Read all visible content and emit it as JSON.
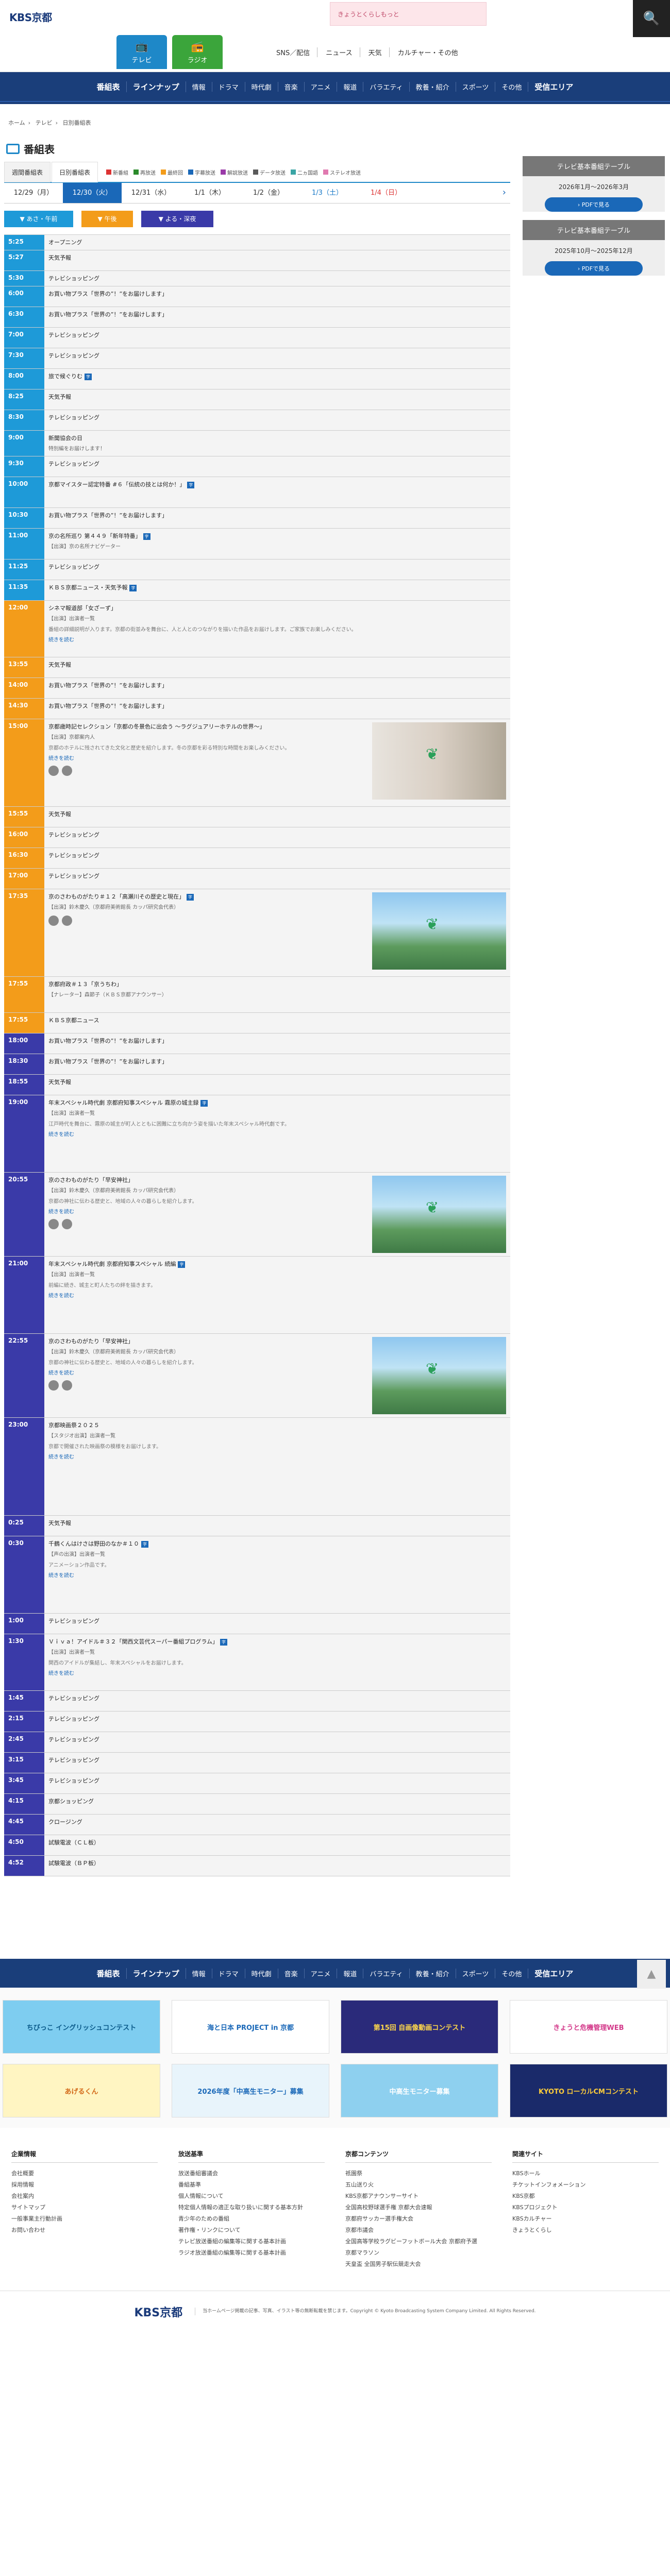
{
  "header": {
    "logo": "KBS京都",
    "banner": "きょうとくらしもっと",
    "tabs": [
      {
        "label": "テレビ",
        "icon": "tv-icon"
      },
      {
        "label": "ラジオ",
        "icon": "radio-icon"
      }
    ],
    "links": [
      "SNS／配信",
      "ニュース",
      "天気",
      "カルチャー・その他"
    ],
    "search_icon": "🔍"
  },
  "nav": [
    "番組表",
    "ラインナップ",
    "情報",
    "ドラマ",
    "時代劇",
    "音楽",
    "アニメ",
    "報道",
    "バラエティ",
    "教養・紹介",
    "スポーツ",
    "その他",
    "受信エリア"
  ],
  "breadcrumb": [
    "ホーム",
    "テレビ",
    "日別番組表"
  ],
  "page_title": "番組表",
  "view_tabs": [
    "週間番組表",
    "日別番組表"
  ],
  "filters": [
    {
      "label": "新番組",
      "color": "#d33"
    },
    {
      "label": "再放送",
      "color": "#2a8a2a"
    },
    {
      "label": "最終回",
      "color": "#f39c1a"
    },
    {
      "label": "字幕放送",
      "color": "#1a68b8"
    },
    {
      "label": "解説放送",
      "color": "#9a3aa8"
    },
    {
      "label": "データ放送",
      "color": "#5a5a5a"
    },
    {
      "label": "二ヵ国語",
      "color": "#3ba5a5"
    },
    {
      "label": "ステレオ放送",
      "color": "#e07ab0"
    }
  ],
  "dates": [
    {
      "label": "12/29（月）",
      "cls": ""
    },
    {
      "label": "12/30（火）",
      "cls": "active"
    },
    {
      "label": "12/31（水）",
      "cls": ""
    },
    {
      "label": "1/1（木）",
      "cls": ""
    },
    {
      "label": "1/2（金）",
      "cls": ""
    },
    {
      "label": "1/3（土）",
      "cls": "sat"
    },
    {
      "label": "1/4（日）",
      "cls": "sun"
    }
  ],
  "tod": [
    {
      "label": "あさ・午前",
      "cls": "morning"
    },
    {
      "label": "午後",
      "cls": "noon"
    },
    {
      "label": "よる・深夜",
      "cls": "night"
    }
  ],
  "side": [
    {
      "title": "テレビ基本番組テーブル",
      "period": "2026年1月〜2026年3月",
      "button": "PDFで見る"
    },
    {
      "title": "テレビ基本番組テーブル",
      "period": "2025年10月〜2025年12月",
      "button": "PDFで見る"
    }
  ],
  "schedule": [
    {
      "time": "5:25",
      "tod": "morning",
      "title": "オープニング",
      "h": 30
    },
    {
      "time": "5:27",
      "tod": "morning",
      "title": "天気予報",
      "h": 40
    },
    {
      "time": "5:30",
      "tod": "morning",
      "title": "テレビショッピング",
      "h": 30
    },
    {
      "time": "6:00",
      "tod": "morning",
      "title": "お買い物プラス「世界の”！”をお届けします」",
      "h": 40
    },
    {
      "time": "6:30",
      "tod": "morning",
      "title": "お買い物プラス「世界の”！”をお届けします」",
      "h": 40
    },
    {
      "time": "7:00",
      "tod": "morning",
      "title": "テレビショッピング",
      "h": 40
    },
    {
      "time": "7:30",
      "tod": "morning",
      "title": "テレビショッピング",
      "h": 40
    },
    {
      "time": "8:00",
      "tod": "morning",
      "title": "旅で候ぐりむ",
      "badge": "字",
      "h": 40
    },
    {
      "time": "8:25",
      "tod": "morning",
      "title": "天気予報",
      "h": 40
    },
    {
      "time": "8:30",
      "tod": "morning",
      "title": "テレビショッピング",
      "h": 40
    },
    {
      "time": "9:00",
      "tod": "morning",
      "title": "新聞協会の日",
      "sub": "特別編をお届けします！",
      "h": 50
    },
    {
      "time": "9:30",
      "tod": "morning",
      "title": "テレビショッピング",
      "h": 40
    },
    {
      "time": "10:00",
      "tod": "morning",
      "title": "京都マイスター認定特番 #６「伝統の技とは何か！」",
      "badge": "字",
      "h": 60
    },
    {
      "time": "10:30",
      "tod": "morning",
      "title": "お買い物プラス「世界の”！”をお届けします」",
      "h": 40
    },
    {
      "time": "11:00",
      "tod": "morning",
      "title": "京の名所巡り 第４４９「新年特番」",
      "badge": "字",
      "sub": "【出演】京の名所ナビゲーター",
      "h": 60
    },
    {
      "time": "11:25",
      "tod": "morning",
      "title": "テレビショッピング",
      "h": 40
    },
    {
      "time": "11:35",
      "tod": "morning",
      "title": "ＫＢＳ京都ニュース・天気予報",
      "badge": "字",
      "h": 40
    },
    {
      "time": "12:00",
      "tod": "noon",
      "title": "シネマ報道部「女ざーず」",
      "sub": "【出演】出演者一覧",
      "desc": "番組の詳細説明が入ります。京都の街並みを舞台に、人と人とのつながりを描いた作品をお届けします。ご家族でお楽しみください。",
      "more": "続きを読む",
      "h": 110
    },
    {
      "time": "13:55",
      "tod": "noon",
      "title": "天気予報",
      "h": 40
    },
    {
      "time": "14:00",
      "tod": "noon",
      "title": "お買い物プラス「世界の”！”をお届けします」",
      "h": 40
    },
    {
      "time": "14:30",
      "tod": "noon",
      "title": "お買い物プラス「世界の”！”をお届けします」",
      "h": 40
    },
    {
      "time": "15:00",
      "tod": "noon",
      "title": "京都歳時記セレクション「京都の冬景色に出会う ～ラグジュアリーホテルの世界～」",
      "sub": "【出演】京都案内人",
      "desc": "京都のホテルに残されてきた文化と歴史を紹介します。冬の京都を彩る特別な時間をお楽しみください。",
      "more": "続きを読む",
      "thumb": "rosary",
      "share": true,
      "h": 170
    },
    {
      "time": "15:55",
      "tod": "noon",
      "title": "天気予報",
      "h": 40
    },
    {
      "time": "16:00",
      "tod": "noon",
      "title": "テレビショッピング",
      "h": 40
    },
    {
      "time": "16:30",
      "tod": "noon",
      "title": "テレビショッピング",
      "h": 40
    },
    {
      "time": "17:00",
      "tod": "noon",
      "title": "テレビショッピング",
      "h": 40
    },
    {
      "time": "17:35",
      "tod": "noon",
      "title": "京のさわものがたり＃１２「高瀬川その歴史と現在」",
      "badge": "字",
      "sub": "【出演】鈴木慶久（京都府美術館長 カッパ研究会代表）",
      "thumb": "river",
      "share": true,
      "h": 170
    },
    {
      "time": "17:55",
      "tod": "noon",
      "title": "京都府政＃１３「京うちわ」",
      "sub": "【ナレーター】森節子（ＫＢＳ京都アナウンサー）",
      "h": 70
    },
    {
      "time": "17:55",
      "tod": "noon",
      "title": "ＫＢＳ京都ニュース",
      "h": 40
    },
    {
      "time": "18:00",
      "tod": "night",
      "title": "お買い物プラス「世界の”！”をお届けします」",
      "h": 40
    },
    {
      "time": "18:30",
      "tod": "night",
      "title": "お買い物プラス「世界の”！”をお届けします」",
      "h": 40
    },
    {
      "time": "18:55",
      "tod": "night",
      "title": "天気予報",
      "h": 40
    },
    {
      "time": "19:00",
      "tod": "night",
      "title": "年末スペシャル時代劇 京都府知事スペシャル 霧原の城主録",
      "badge": "字",
      "sub": "【出演】出演者一覧",
      "desc": "江戸時代を舞台に、霧原の城主が町人とともに困難に立ち向かう姿を描いた年末スペシャル時代劇です。",
      "more": "続きを読む",
      "h": 150
    },
    {
      "time": "20:55",
      "tod": "night",
      "title": "京のさわものがたり「早安神社」",
      "sub": "【出演】鈴木慶久（京都府美術館長 カッパ研究会代表）",
      "desc": "京都の神社に伝わる歴史と、地域の人々の暮らしを紹介します。",
      "more": "続きを読む",
      "thumb": "river",
      "share": true,
      "h": 160
    },
    {
      "time": "21:00",
      "tod": "night",
      "title": "年末スペシャル時代劇 京都府知事スペシャル 続編",
      "badge": "字",
      "sub": "【出演】出演者一覧",
      "desc": "前編に続き、城主と町人たちの絆を描きます。",
      "more": "続きを読む",
      "h": 150
    },
    {
      "time": "22:55",
      "tod": "night",
      "title": "京のさわものがたり「早安神社」",
      "sub": "【出演】鈴木慶久（京都府美術館長 カッパ研究会代表）",
      "desc": "京都の神社に伝わる歴史と、地域の人々の暮らしを紹介します。",
      "more": "続きを読む",
      "thumb": "river",
      "share": true,
      "h": 160
    },
    {
      "time": "23:00",
      "tod": "night",
      "title": "京都映画祭２０２５",
      "sub": "【スタジオ出演】出演者一覧",
      "desc": "京都で開催された映画祭の模様をお届けします。",
      "more": "続きを読む",
      "h": 190
    },
    {
      "time": "0:25",
      "tod": "night",
      "title": "天気予報",
      "h": 40
    },
    {
      "time": "0:30",
      "tod": "night",
      "title": "千鶴くんはけさは野田のなか＃１０",
      "badge": "字",
      "sub": "【声の出演】出演者一覧",
      "desc": "アニメーション作品です。",
      "more": "続きを読む",
      "h": 150
    },
    {
      "time": "1:00",
      "tod": "night",
      "title": "テレビショッピング",
      "h": 40
    },
    {
      "time": "1:30",
      "tod": "night",
      "title": "Ｖｉｖａ！アイドル＃３２「関西文芸代スーパー番組プログラム」",
      "badge": "字",
      "sub": "【出演】出演者一覧",
      "desc": "関西のアイドルが集結し、年末スペシャルをお届けします。",
      "more": "続きを読む",
      "h": 110
    },
    {
      "time": "1:45",
      "tod": "night",
      "title": "テレビショッピング",
      "h": 40
    },
    {
      "time": "2:15",
      "tod": "night",
      "title": "テレビショッピング",
      "h": 40
    },
    {
      "time": "2:45",
      "tod": "night",
      "title": "テレビショッピング",
      "h": 40
    },
    {
      "time": "3:15",
      "tod": "night",
      "title": "テレビショッピング",
      "h": 40
    },
    {
      "time": "3:45",
      "tod": "night",
      "title": "テレビショッピング",
      "h": 40
    },
    {
      "time": "4:15",
      "tod": "night",
      "title": "京都ショッピング",
      "h": 40
    },
    {
      "time": "4:45",
      "tod": "night",
      "title": "クロージング",
      "h": 40
    },
    {
      "time": "4:50",
      "tod": "night",
      "title": "試験電波（ＣＬ板）",
      "h": 40
    },
    {
      "time": "4:52",
      "tod": "night",
      "title": "試験電波（ＢＰ板）",
      "h": 40
    }
  ],
  "to_top": "▲",
  "footer_nav": [
    "番組表",
    "ラインナップ",
    "情報",
    "ドラマ",
    "時代劇",
    "音楽",
    "アニメ",
    "報道",
    "バラエティ",
    "教養・紹介",
    "スポーツ",
    "その他",
    "受信エリア"
  ],
  "banners": [
    {
      "label": "ちびっこ イングリッシュコンテスト",
      "cls": "b1"
    },
    {
      "label": "海と日本 PROJECT in 京都",
      "cls": "b2"
    },
    {
      "label": "第15回 自画像動画コンテスト",
      "cls": "b3"
    },
    {
      "label": "きょうと危機管理WEB",
      "cls": "b4"
    },
    {
      "label": "あげるくん",
      "cls": "b5"
    },
    {
      "label": "2026年度「中高生モニター」募集",
      "cls": "b6"
    },
    {
      "label": "中高生モニター募集",
      "cls": "b7"
    },
    {
      "label": "KYOTO ローカルCMコンテスト",
      "cls": "b8"
    }
  ],
  "footer_cols": [
    {
      "title": "企業情報",
      "items": [
        "会社概要",
        "採用情報",
        "会社案内",
        "サイトマップ",
        "一般事業主行動計画",
        "お問い合わせ"
      ]
    },
    {
      "title": "放送基準",
      "items": [
        "放送番組審議会",
        "番組基準",
        "個人情報について",
        "特定個人情報の適正な取り扱いに関する基本方針",
        "青少年のための番組",
        "著作権・リンクについて",
        "テレビ放送番組の編集等に関する基本計画",
        "ラジオ放送番組の編集等に関する基本計画"
      ]
    },
    {
      "title": "京都コンテンツ",
      "items": [
        "祇園祭",
        "五山送り火",
        "KBS京都アナウンサーサイト",
        "全国高校野球選手権 京都大会速報",
        "京都府サッカー選手権大会",
        "京都市議会",
        "全国高等学校ラグビーフットボール大会 京都府予選",
        "京都マラソン",
        "天皇盃 全国男子駅伝競走大会"
      ]
    },
    {
      "title": "関連サイト",
      "items": [
        "KBSホール",
        "チケットインフォメーション",
        "KBS京都",
        "KBSプロジェクト",
        "KBSカルチャー",
        "きょうとくらし"
      ]
    }
  ],
  "copyright": {
    "logo": "KBS京都",
    "text": "当ホームページ掲載の記事、写真、イラスト等の無断転載を禁じます。Copyright © Kyoto Broadcasting System Company Limited. All Rights Reserved."
  }
}
